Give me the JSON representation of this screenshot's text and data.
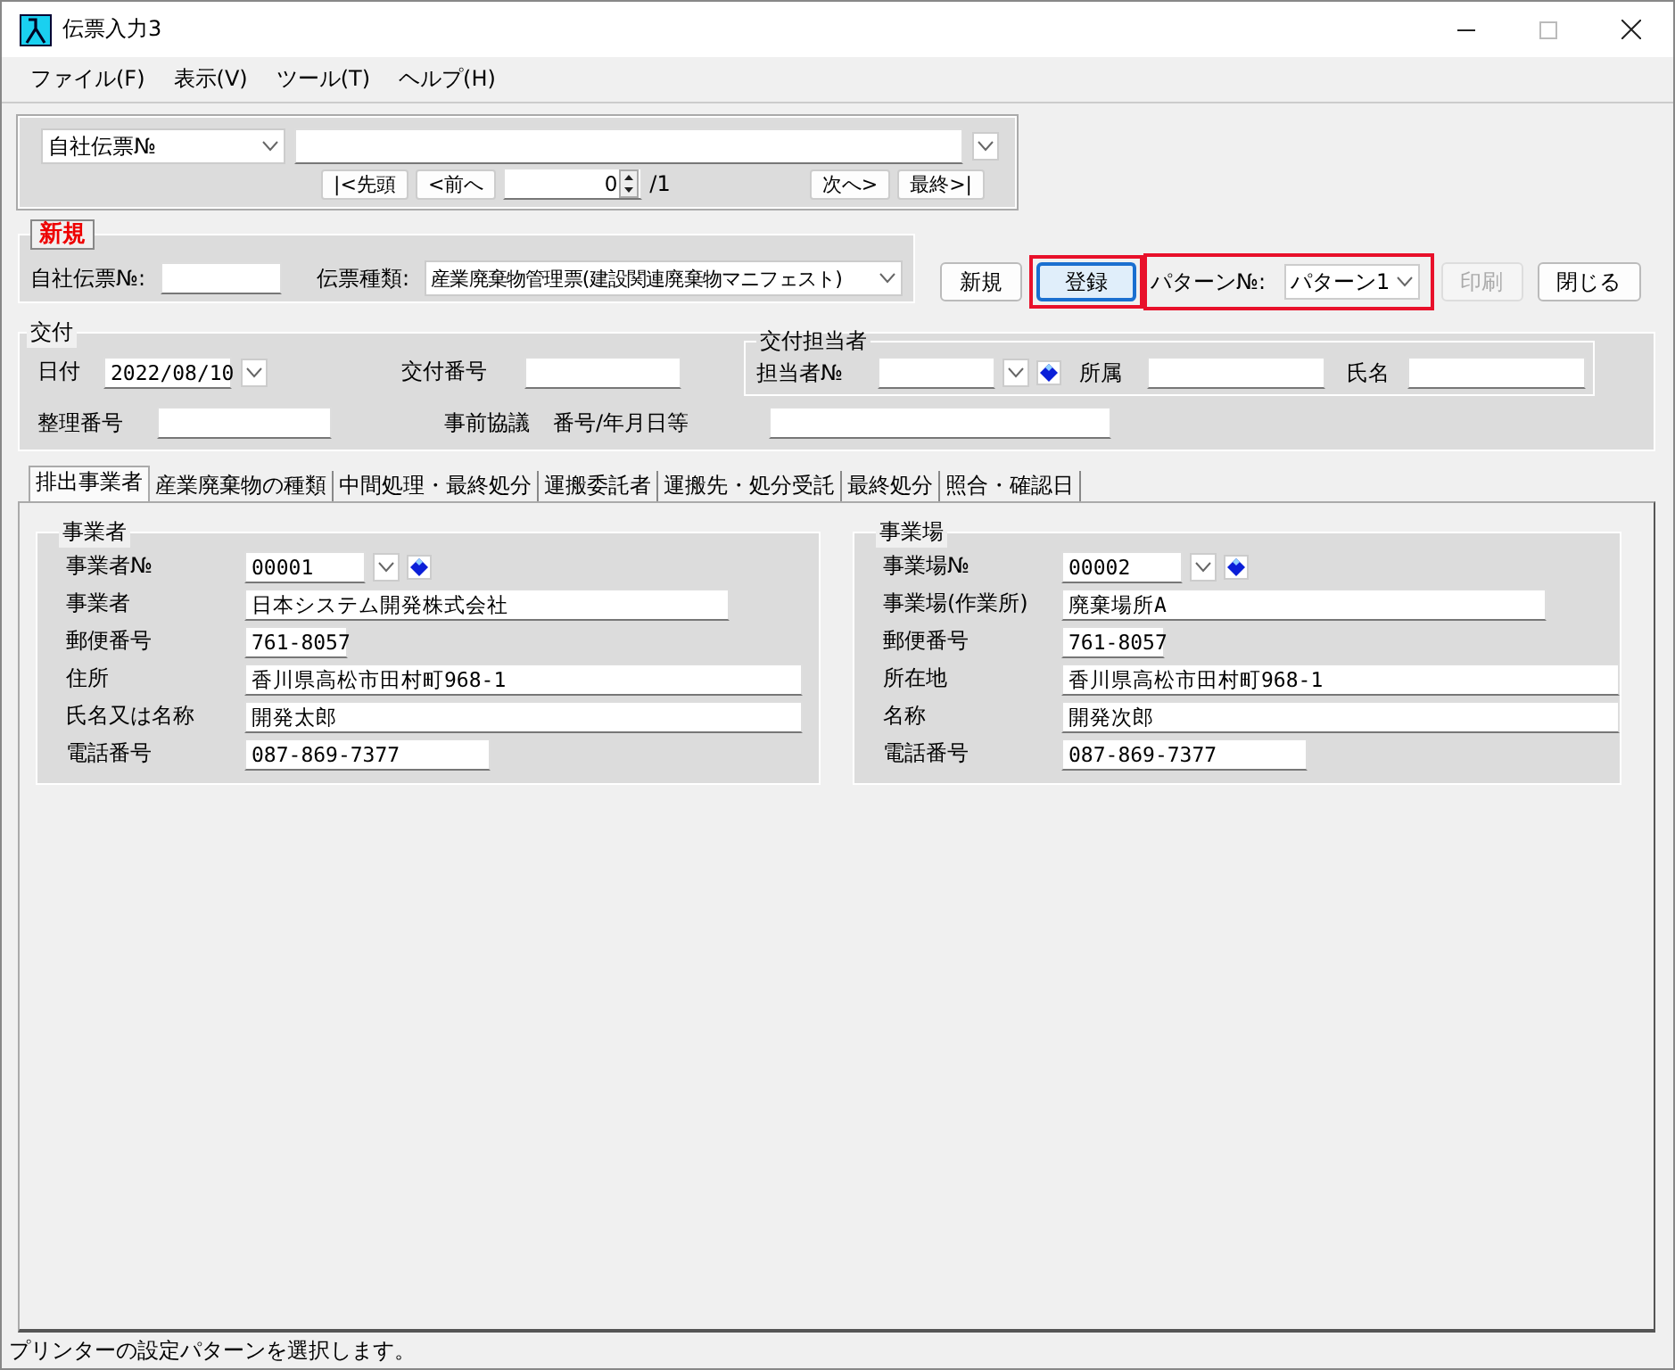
{
  "window": {
    "title": "伝票入力3"
  },
  "menu": [
    {
      "label": "ファイル(F)"
    },
    {
      "label": "表示(V)"
    },
    {
      "label": "ツール(T)"
    },
    {
      "label": "ヘルプ(H)"
    }
  ],
  "navigator": {
    "search_key": "自社伝票№",
    "first": "|<先頭",
    "prev": "<前へ",
    "page": "0",
    "total": "/1",
    "next": "次へ>",
    "last": "最終>|"
  },
  "header": {
    "badge": "新規",
    "slip_no_label": "自社伝票№:",
    "slip_type_label": "伝票種類:",
    "slip_type": "産業廃棄物管理票(建設関連廃棄物マニフェスト)"
  },
  "toolbar": [
    {
      "kind": "button",
      "label": "新規",
      "disabled": false,
      "focused": false,
      "highlighted": false
    },
    {
      "kind": "button",
      "label": "登録",
      "disabled": false,
      "focused": true,
      "highlighted": true
    },
    {
      "kind": "select",
      "label": "パターン№:",
      "value": "パターン1",
      "disabled": false,
      "focused": false,
      "highlighted": true
    },
    {
      "kind": "button",
      "label": "印刷",
      "disabled": true,
      "focused": false,
      "highlighted": false
    },
    {
      "kind": "button",
      "label": "閉じる",
      "disabled": false,
      "focused": false,
      "highlighted": false
    }
  ],
  "issue": {
    "title": "交付",
    "date_label": "日付",
    "date": "2022/08/10",
    "issue_no_label": "交付番号",
    "ref_no_label": "整理番号",
    "prior_label": "事前協議",
    "prior_sublabel": "番号/年月日等",
    "staff": {
      "title": "交付担当者",
      "no_label": "担当者№",
      "dept_label": "所属",
      "name_label": "氏名"
    }
  },
  "tabs": [
    {
      "label": "排出事業者",
      "selected": true
    },
    {
      "label": "産業廃棄物の種類",
      "selected": false
    },
    {
      "label": "中間処理・最終処分",
      "selected": false
    },
    {
      "label": "運搬委託者",
      "selected": false
    },
    {
      "label": "運搬先・処分受託",
      "selected": false
    },
    {
      "label": "最終処分",
      "selected": false
    },
    {
      "label": "照合・確認日",
      "selected": false
    }
  ],
  "groups": [
    {
      "title": "事業者",
      "rows": [
        {
          "kind": "lookup",
          "label": "事業者№",
          "value": "00001"
        },
        {
          "kind": "name",
          "label": "事業者",
          "value": "日本システム開発株式会社"
        },
        {
          "kind": "postal",
          "label": "郵便番号",
          "value": "761-8057"
        },
        {
          "kind": "address",
          "label": "住所",
          "value": "香川県高松市田村町968-1"
        },
        {
          "kind": "address",
          "label": "氏名又は名称",
          "value": "開発太郎"
        },
        {
          "kind": "phone",
          "label": "電話番号",
          "value": "087-869-7377"
        }
      ]
    },
    {
      "title": "事業場",
      "rows": [
        {
          "kind": "lookup",
          "label": "事業場№",
          "value": "00002"
        },
        {
          "kind": "name",
          "label": "事業場(作業所)",
          "value": "廃棄場所A"
        },
        {
          "kind": "postal",
          "label": "郵便番号",
          "value": "761-8057"
        },
        {
          "kind": "address",
          "label": "所在地",
          "value": "香川県高松市田村町968-1"
        },
        {
          "kind": "address",
          "label": "名称",
          "value": "開発次郎"
        },
        {
          "kind": "phone",
          "label": "電話番号",
          "value": "087-869-7377"
        }
      ]
    }
  ],
  "status_bar": {
    "text": "プリンターの設定パターンを選択します。"
  }
}
